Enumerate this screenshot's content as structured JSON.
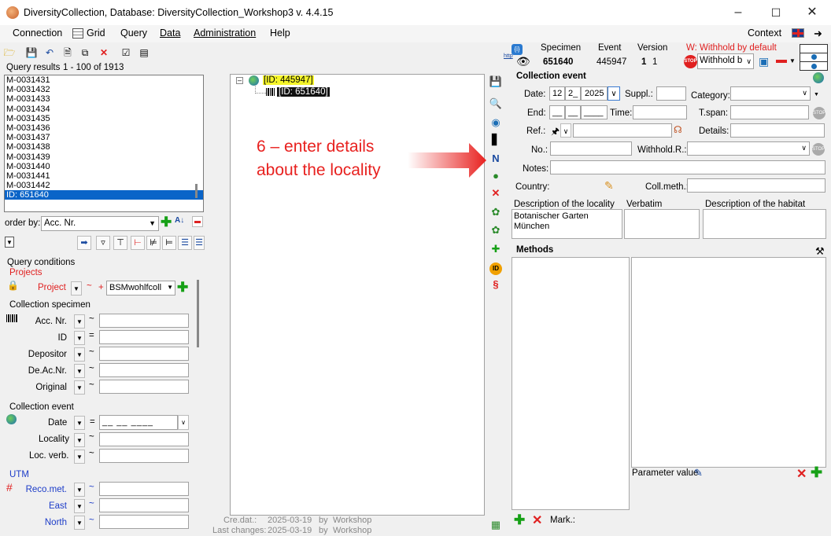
{
  "window": {
    "title": "DiversityCollection,  Database: DiversityCollection_Workshop3    v. 4.4.15"
  },
  "menu": {
    "connection": "Connection",
    "grid": "Grid",
    "query": "Query",
    "data": "Data",
    "administration": "Administration",
    "help": "Help",
    "context": "Context"
  },
  "query_results": {
    "label": "Query results",
    "range": "1 - 100 of 1913",
    "items": [
      "M-0031431",
      "M-0031432",
      "M-0031433",
      "M-0031434",
      "M-0031435",
      "M-0031436",
      "M-0031437",
      "M-0031438",
      "M-0031439",
      "M-0031440",
      "M-0031441",
      "M-0031442",
      "ID: 651640"
    ],
    "order_by_label": "order by:",
    "order_by_value": "Acc. Nr."
  },
  "query_conditions": {
    "title": "Query conditions",
    "projects_title": "Projects",
    "project_label": "Project",
    "project_value": "BSMwohlfcoll",
    "collection_specimen_title": "Collection specimen",
    "specimen_fields": [
      {
        "label": "Acc. Nr.",
        "op": "~"
      },
      {
        "label": "ID",
        "op": "="
      },
      {
        "label": "Depositor",
        "op": "~"
      },
      {
        "label": "De.Ac.Nr.",
        "op": "~"
      },
      {
        "label": "Original",
        "op": "~"
      }
    ],
    "collection_event_title": "Collection event",
    "date_label": "Date",
    "date_op": "=",
    "date_placeholder": "__ __ ____",
    "locality_label": "Locality",
    "locality_op": "~",
    "locverb_label": "Loc. verb.",
    "locverb_op": "~",
    "utm_title": "UTM",
    "utm_fields": [
      {
        "label": "Reco.met.",
        "op": "~"
      },
      {
        "label": "East",
        "op": "~"
      },
      {
        "label": "North",
        "op": "~"
      }
    ]
  },
  "tree": {
    "event_node": "[ID: 445947]",
    "specimen_node": "[ID: 651640]"
  },
  "annotation": {
    "line1": "6 – enter details",
    "line2": "about the locality",
    "color": "#e8211f"
  },
  "footer": {
    "created_label": "Cre.dat.:",
    "created_date": "2025-03-19",
    "created_by_label": "by",
    "created_by": "Workshop",
    "changed_label": "Last changes:",
    "changed_date": "2025-03-19",
    "changed_by_label": "by",
    "changed_by": "Workshop"
  },
  "header_info": {
    "specimen_label": "Specimen",
    "specimen_value": "651640",
    "event_label": "Event",
    "event_value": "445947",
    "version_label": "Version",
    "version_value": "1",
    "version_value2": "1",
    "withhold_label": "W: Withhold by default",
    "withhold_value": "Withhold b"
  },
  "event_panel": {
    "title": "Collection event",
    "date_label": "Date:",
    "date_day": "12",
    "date_month": "2_",
    "date_year": "2025",
    "suppl_label": "Suppl.:",
    "category_label": "Category:",
    "end_label": "End:",
    "end_day": "__",
    "end_month": "__",
    "end_year": "____",
    "time_label": "Time:",
    "tspan_label": "T.span:",
    "ref_label": "Ref.:",
    "details_label": "Details:",
    "no_label": "No.:",
    "withhold_r_label": "Withhold.R.:",
    "notes_label": "Notes:",
    "country_label": "Country:",
    "coll_meth_label": "Coll.meth.:",
    "desc_locality_label": "Description of the locality",
    "desc_locality_value": "Botanischer Garten\nMünchen",
    "verbatim_label": "Verbatim",
    "desc_habitat_label": "Description of the habitat"
  },
  "methods": {
    "title": "Methods",
    "param_label": "Parameter value",
    "mark_label": "Mark.:"
  }
}
